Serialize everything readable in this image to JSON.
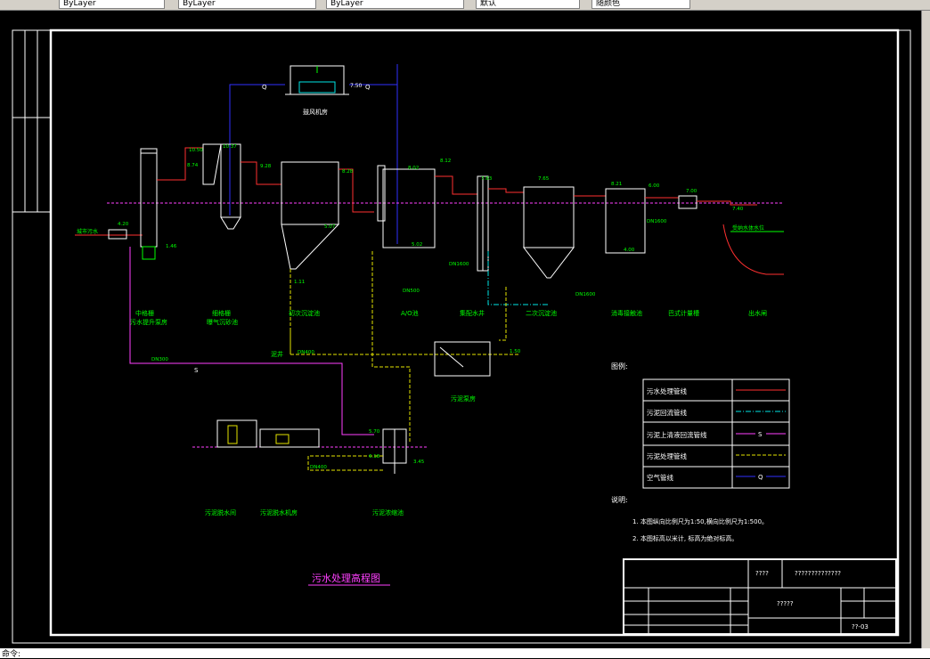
{
  "toolbar": {
    "fields": [
      "ByLayer",
      "ByLayer",
      "ByLayer",
      "默认",
      "随颜色"
    ]
  },
  "status": {
    "text": "命令:"
  },
  "drawing": {
    "title": "污水处理高程图",
    "blower_label": "鼓风机房",
    "units": [
      "中格栅\n污水提升泵房",
      "细格栅\n曝气沉砂池",
      "初次沉淀池",
      "A/O池",
      "集配水井",
      "二次沉淀池",
      "消毒接触池",
      "巴式计量槽",
      "出水闸"
    ],
    "lower_units": [
      "污泥脱水间",
      "污泥脱水机房",
      "污泥浓缩池",
      "污泥泵房",
      "泥井"
    ],
    "inlet_label": "城市污水",
    "outlet_label": "受纳水体水位",
    "legend": {
      "title": "图例:",
      "rows": [
        {
          "label": "污水处理管线",
          "symbol": "",
          "color": "#ff3030"
        },
        {
          "label": "污泥回流管线",
          "symbol": "",
          "color": "#00e5e5"
        },
        {
          "label": "污泥上清液回流管线",
          "symbol": "S",
          "color": "#ff40ff"
        },
        {
          "label": "污泥处理管线",
          "symbol": "",
          "color": "#e5e500"
        },
        {
          "label": "空气管线",
          "symbol": "Q",
          "color": "#3030ff"
        }
      ]
    },
    "notes": {
      "title": "说明:",
      "items": [
        "1. 本图纵向比例尺为1:50,横向比例尺为1:500。",
        "2. 本图标高以米计, 标高为绝对标高。"
      ]
    },
    "titleblock": {
      "top_left": "????",
      "top_right": "??????????????",
      "center": "?????",
      "code": "??-03"
    },
    "colors": {
      "frame": "#ffffff",
      "water": "#ff3030",
      "return": "#00e5e5",
      "supernatant": "#ff40ff",
      "sludge": "#e5e500",
      "air": "#3030ff",
      "label": "#00ff00",
      "structure": "#ffffff"
    }
  }
}
